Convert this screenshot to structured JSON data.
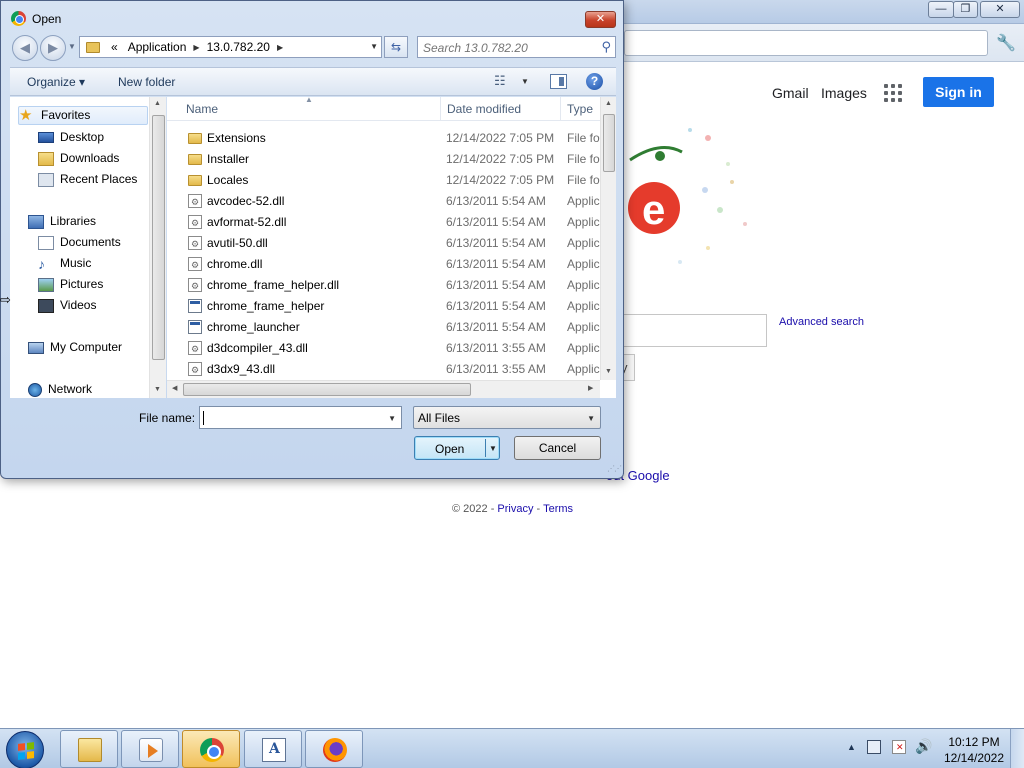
{
  "chrome": {
    "header": {
      "gmail": "Gmail",
      "images": "Images",
      "sign_in": "Sign in"
    },
    "advanced_search": "Advanced search",
    "button_fragment": "y",
    "about_fragment": "out Google",
    "footer": {
      "copyright": "© 2022 -",
      "privacy": "Privacy",
      "separator": "-",
      "terms": "Terms"
    }
  },
  "dialog": {
    "title": "Open",
    "close_glyph": "✕",
    "address": {
      "overflow": "«",
      "segments": [
        "Application",
        "13.0.782.20"
      ]
    },
    "search_placeholder": "Search 13.0.782.20",
    "toolbar": {
      "organize": "Organize ▾",
      "new_folder": "New folder"
    },
    "nav": {
      "items": [
        {
          "label": "Favorites",
          "icon": "star-icon"
        },
        {
          "label": "Desktop",
          "icon": "desktop-icon"
        },
        {
          "label": "Downloads",
          "icon": "downloads-icon"
        },
        {
          "label": "Recent Places",
          "icon": "recent-places-icon"
        },
        {
          "label": "Libraries",
          "icon": "libraries-icon"
        },
        {
          "label": "Documents",
          "icon": "documents-icon"
        },
        {
          "label": "Music",
          "icon": "music-icon"
        },
        {
          "label": "Pictures",
          "icon": "pictures-icon"
        },
        {
          "label": "Videos",
          "icon": "videos-icon"
        },
        {
          "label": "My Computer",
          "icon": "computer-icon"
        },
        {
          "label": "Network",
          "icon": "network-icon"
        }
      ]
    },
    "columns": {
      "name": "Name",
      "date": "Date modified",
      "type": "Type"
    },
    "files": [
      {
        "name": "Extensions",
        "date": "12/14/2022 7:05 PM",
        "type": "File folder",
        "icon": "folder-icon"
      },
      {
        "name": "Installer",
        "date": "12/14/2022 7:05 PM",
        "type": "File folder",
        "icon": "folder-icon"
      },
      {
        "name": "Locales",
        "date": "12/14/2022 7:05 PM",
        "type": "File folder",
        "icon": "folder-icon"
      },
      {
        "name": "avcodec-52.dll",
        "date": "6/13/2011 5:54 AM",
        "type": "Application extension",
        "icon": "dll-icon"
      },
      {
        "name": "avformat-52.dll",
        "date": "6/13/2011 5:54 AM",
        "type": "Application extension",
        "icon": "dll-icon"
      },
      {
        "name": "avutil-50.dll",
        "date": "6/13/2011 5:54 AM",
        "type": "Application extension",
        "icon": "dll-icon"
      },
      {
        "name": "chrome.dll",
        "date": "6/13/2011 5:54 AM",
        "type": "Application extension",
        "icon": "dll-icon"
      },
      {
        "name": "chrome_frame_helper.dll",
        "date": "6/13/2011 5:54 AM",
        "type": "Application extension",
        "icon": "dll-icon"
      },
      {
        "name": "chrome_frame_helper",
        "date": "6/13/2011 5:54 AM",
        "type": "Application",
        "icon": "exe-icon"
      },
      {
        "name": "chrome_launcher",
        "date": "6/13/2011 5:54 AM",
        "type": "Application",
        "icon": "exe-icon"
      },
      {
        "name": "d3dcompiler_43.dll",
        "date": "6/13/2011 3:55 AM",
        "type": "Application extension",
        "icon": "dll-icon"
      },
      {
        "name": "d3dx9_43.dll",
        "date": "6/13/2011 3:55 AM",
        "type": "Application extension",
        "icon": "dll-icon"
      }
    ],
    "file_name_label": "File name:",
    "file_name_value": "",
    "filter": "All Files",
    "open_label": "Open",
    "cancel_label": "Cancel"
  },
  "taskbar": {
    "time": "10:12 PM",
    "date": "12/14/2022"
  }
}
